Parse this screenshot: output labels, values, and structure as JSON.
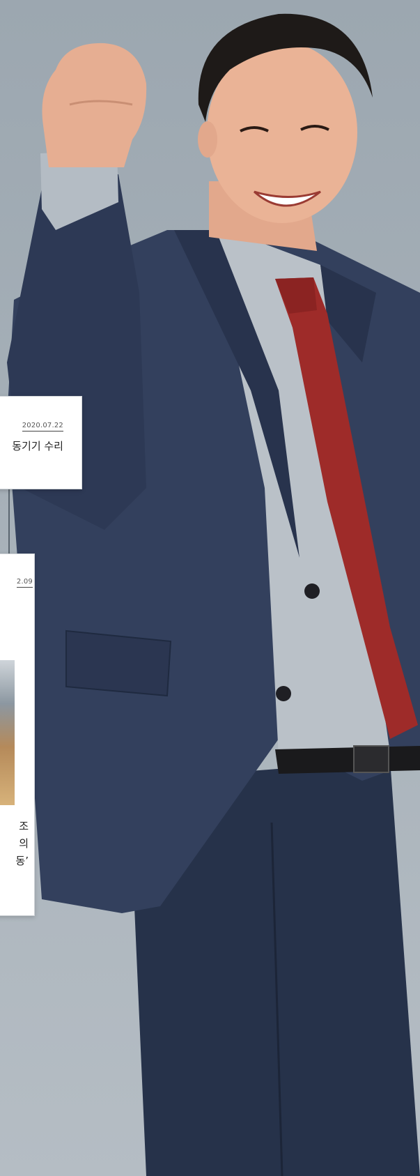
{
  "card1": {
    "date": "2020.07.22",
    "title": "동기기 수리"
  },
  "card2": {
    "date": "2.09",
    "lines": [
      "조",
      "의",
      "동’"
    ]
  },
  "colors": {
    "background": "#a6b0b8",
    "jacket": "#2f3b57",
    "shirt": "#b9c0c7",
    "tie": "#9c2a28",
    "skin": "#e9b194",
    "hair": "#1e1a18"
  }
}
